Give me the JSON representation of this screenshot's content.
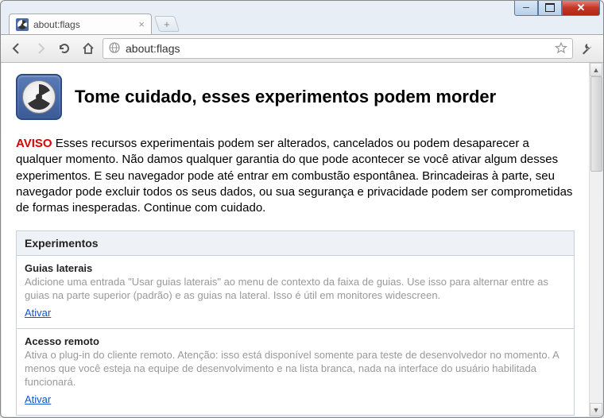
{
  "window": {
    "tab_title": "about:flags"
  },
  "toolbar": {
    "url": "about:flags"
  },
  "page": {
    "title": "Tome cuidado, esses experimentos podem morder",
    "warn_label": "AVISO",
    "warn_text": " Esses recursos experimentais podem ser alterados, cancelados ou podem desaparecer a qualquer momento. Não damos qualquer garantia do que pode acontecer se você ativar algum desses experimentos. E seu navegador pode até entrar em combustão espontânea. Brincadeiras à parte, seu navegador pode excluir todos os seus dados, ou sua segurança e privacidade podem ser comprometidas de formas inesperadas. Continue com cuidado.",
    "section_header": "Experimentos"
  },
  "experiments": [
    {
      "title": "Guias laterais",
      "desc": "Adicione uma entrada \"Usar guias laterais\" ao menu de contexto da faixa de guias. Use isso para alternar entre as guias na parte superior (padrão) e as guias na lateral. Isso é útil em monitores widescreen.",
      "action": "Ativar"
    },
    {
      "title": "Acesso remoto",
      "desc": "Ativa o plug-in do cliente remoto. Atenção: isso está disponível somente para teste de desenvolvedor no momento. A menos que você esteja na equipe de desenvolvimento e na lista branca, nada na interface do usuário habilitada funcionará.",
      "action": "Ativar"
    }
  ]
}
